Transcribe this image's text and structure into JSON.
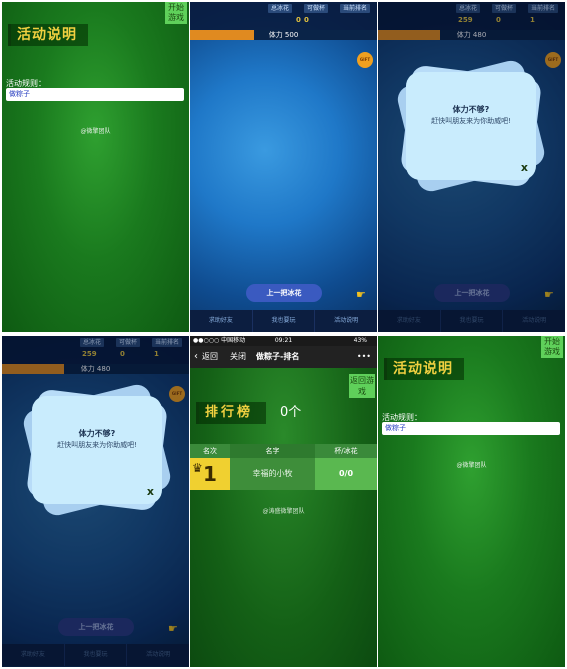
{
  "activity": {
    "title": "活动说明",
    "start_button": "开始游戏",
    "rules_label": "活动规则：",
    "rules_value": "做粽子",
    "team": "@微擎团队"
  },
  "game": {
    "stats": [
      {
        "label": "总冰花",
        "value": "0"
      },
      {
        "label": "可做杯",
        "value": "0"
      },
      {
        "label": "当前排名",
        "value": ""
      }
    ],
    "stats_b": [
      {
        "label": "总冰花",
        "value": "259"
      },
      {
        "label": "可做杯",
        "value": "0"
      },
      {
        "label": "当前排名",
        "value": "1"
      }
    ],
    "stamina_label": "体力 500",
    "stamina_label_b": "体力 480",
    "stamina_fraction": 0.34,
    "stamina_fraction_b": 0.33,
    "badge": "GIFT",
    "prev_button": "上一把冰花",
    "tabs": [
      "求助好友",
      "我也要玩",
      "活动说明"
    ]
  },
  "modal": {
    "title": "体力不够?",
    "subtitle": "赶快叫朋友来为你助威吧!",
    "close": "x"
  },
  "ranking": {
    "status_left": "●●○○○ 中国移动",
    "status_time": "09:21",
    "status_right": "43%",
    "nav_back": "返回",
    "nav_close": "关闭",
    "nav_title": "做粽子-排名",
    "nav_more": "•••",
    "title": "排行榜",
    "count": "0个",
    "back_game": "返回游戏",
    "headers": [
      "名次",
      "名字",
      "杯/冰花"
    ],
    "row": {
      "rank": "1",
      "name": "幸福的小牧",
      "score": "0/0"
    },
    "team": "@涛盛微擎团队"
  },
  "colors": {
    "green_accent": "#5fd05a",
    "title_gold": "#f0d040",
    "game_blue": "#1f78c8",
    "stamina_orange": "#e08a20"
  }
}
